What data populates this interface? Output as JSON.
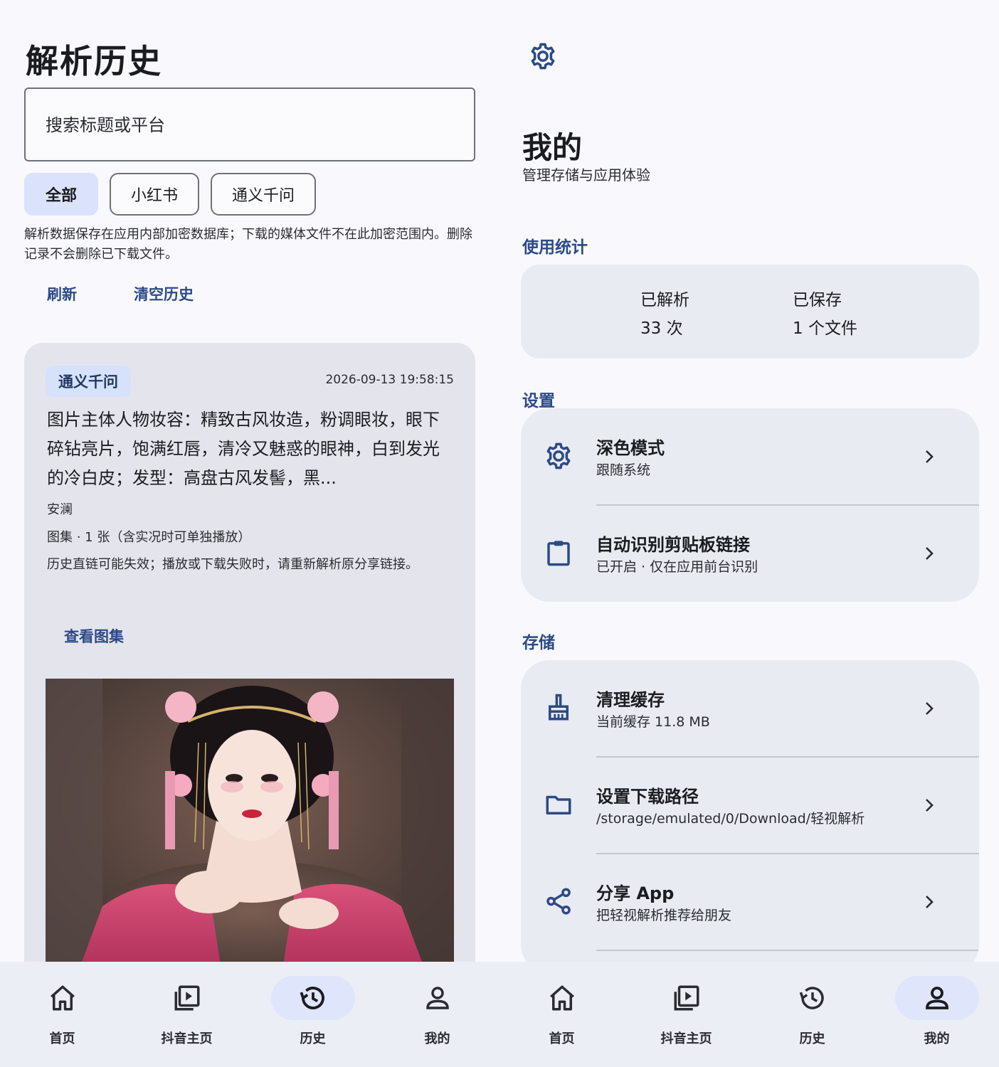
{
  "history": {
    "title": "解析历史",
    "search_placeholder": "搜索标题或平台",
    "filters": [
      "全部",
      "小红书",
      "通义千问"
    ],
    "note": "解析数据保存在应用内部加密数据库；下载的媒体文件不在此加密范围内。删除记录不会删除已下载文件。",
    "refresh_label": "刷新",
    "clear_label": "清空历史",
    "card": {
      "platform": "通义千问",
      "time": "2026-09-13 19:58:15",
      "description": "图片主体人物妆容：精致古风妆造，粉调眼妆，眼下碎钻亮片，饱满红唇，清冷又魅惑的眼神，白到发光的冷白皮；发型：高盘古风发髻，黑...",
      "author": "安澜",
      "meta": "图集 · 1 张（含实况时可单独播放）",
      "warning": "历史直链可能失效；播放或下载失败时，请重新解析原分享链接。",
      "link_label": "查看图集"
    }
  },
  "me": {
    "title": "我的",
    "subtitle": "管理存储与应用体验",
    "stats_label": "使用统计",
    "stats": {
      "parsed_label": "已解析",
      "parsed_value": "33 次",
      "saved_label": "已保存",
      "saved_value": "1 个文件"
    },
    "settings_label": "设置",
    "settings": [
      {
        "title": "深色模式",
        "subtitle": "跟随系统",
        "icon": "gear-icon"
      },
      {
        "title": "自动识别剪贴板链接",
        "subtitle": "已开启 · 仅在应用前台识别",
        "icon": "clipboard-icon"
      }
    ],
    "storage_label": "存储",
    "storage": [
      {
        "title": "清理缓存",
        "subtitle": "当前缓存 11.8 MB",
        "icon": "broom-icon"
      },
      {
        "title": "设置下载路径",
        "subtitle": "/storage/emulated/0/Download/轻视解析",
        "icon": "folder-icon"
      },
      {
        "title": "分享 App",
        "subtitle": "把轻视解析推荐给朋友",
        "icon": "share-icon"
      }
    ]
  },
  "nav": {
    "items": [
      "首页",
      "抖音主页",
      "历史",
      "我的"
    ]
  },
  "colors": {
    "accent": "#2c4a86",
    "chip_selected": "#dbe2fb",
    "card_bg": "#e4e5ec",
    "nav_bg": "#eceef6"
  }
}
